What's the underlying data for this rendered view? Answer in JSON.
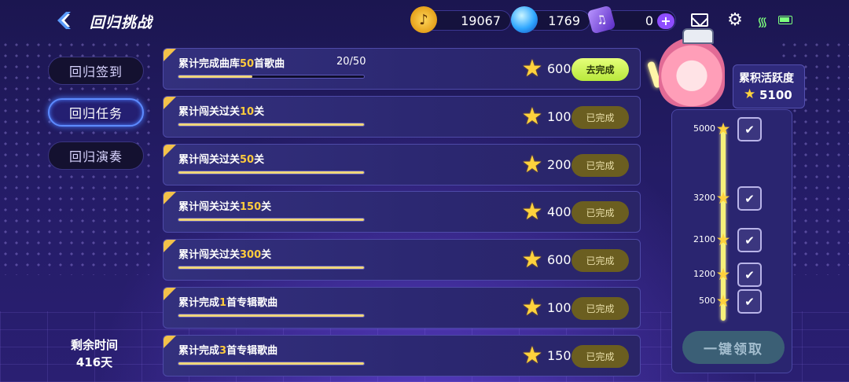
{
  "header": {
    "title": "回归挑战",
    "currencies": [
      {
        "name": "coin",
        "icon": "music-coin-icon",
        "value": "19067"
      },
      {
        "name": "gem",
        "icon": "blue-orb-icon",
        "value": "1769"
      },
      {
        "name": "ticket",
        "icon": "purple-ticket-icon",
        "value": "0"
      }
    ],
    "plus_label": "+"
  },
  "tabs": [
    {
      "label": "回归签到",
      "active": false
    },
    {
      "label": "回归任务",
      "active": true
    },
    {
      "label": "回归演奏",
      "active": false
    }
  ],
  "remaining": {
    "label": "剩余时间",
    "value": "416天"
  },
  "tasks": [
    {
      "pre": "累计完成曲库",
      "num": "50",
      "post": "首歌曲",
      "count": "20/50",
      "progress": 0.4,
      "reward": "600",
      "button": "去完成",
      "state": "go"
    },
    {
      "pre": "累计闯关过关",
      "num": "10",
      "post": "关",
      "count": "",
      "progress": 1.0,
      "reward": "100",
      "button": "已完成",
      "state": "done"
    },
    {
      "pre": "累计闯关过关",
      "num": "50",
      "post": "关",
      "count": "",
      "progress": 1.0,
      "reward": "200",
      "button": "已完成",
      "state": "done"
    },
    {
      "pre": "累计闯关过关",
      "num": "150",
      "post": "关",
      "count": "",
      "progress": 1.0,
      "reward": "400",
      "button": "已完成",
      "state": "done"
    },
    {
      "pre": "累计闯关过关",
      "num": "300",
      "post": "关",
      "count": "",
      "progress": 1.0,
      "reward": "600",
      "button": "已完成",
      "state": "done"
    },
    {
      "pre": "累计完成",
      "num": "1",
      "post": "首专辑歌曲",
      "count": "",
      "progress": 1.0,
      "reward": "100",
      "button": "已完成",
      "state": "done"
    },
    {
      "pre": "累计完成",
      "num": "3",
      "post": "首专辑歌曲",
      "count": "",
      "progress": 1.0,
      "reward": "150",
      "button": "已完成",
      "state": "done"
    }
  ],
  "activity": {
    "title": "累积活跃度",
    "score": "5100",
    "milestones": [
      {
        "value": "5000",
        "icon": "check-icon"
      },
      {
        "value": "3200",
        "icon": "check-icon"
      },
      {
        "value": "2100",
        "icon": "check-icon"
      },
      {
        "value": "1200",
        "icon": "check-icon"
      },
      {
        "value": "500",
        "icon": "check-icon"
      }
    ],
    "claim_label": "一键领取"
  },
  "colors": {
    "accent_yellow": "#ffcb3d",
    "go_button": "#c8f04a",
    "done_button": "#6b5e20",
    "active_tab_border": "#5d8bff"
  }
}
